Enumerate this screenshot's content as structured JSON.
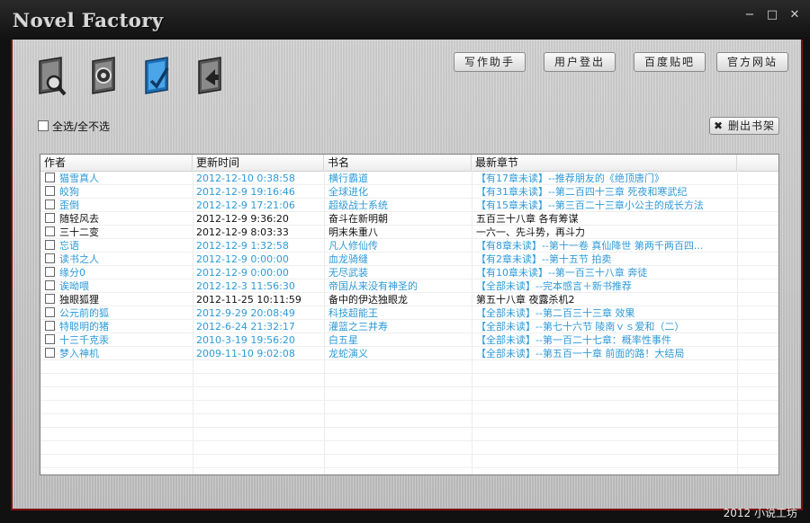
{
  "app": {
    "title": "Novel Factory",
    "footer": "2012 小说工坊"
  },
  "window_controls": {
    "minimize": "−",
    "maximize": "□",
    "close": "✕"
  },
  "toolbar": {
    "icons": [
      "search-book-icon",
      "settings-book-icon",
      "add-book-icon",
      "update-book-icon"
    ],
    "buttons": [
      "写作助手",
      "用户登出",
      "百度贴吧",
      "官方网站"
    ]
  },
  "controls": {
    "select_all": "全选/全不选",
    "delete_label": "删出书架",
    "delete_icon": "✖"
  },
  "table": {
    "headers": [
      "作者",
      "更新时间",
      "书名",
      "最新章节"
    ],
    "rows": [
      {
        "author": "猫雪真人",
        "time": "2012-12-10 0:38:58",
        "book": "横行霸道",
        "chapter": "【有17章未读】--推荐朋友的《绝顶唐门》",
        "style": "blue"
      },
      {
        "author": "皎狗",
        "time": "2012-12-9 19:16:46",
        "book": "全球进化",
        "chapter": "【有31章未读】--第二百四十三章  死夜和寒武纪",
        "style": "blue"
      },
      {
        "author": "歪倒",
        "time": "2012-12-9 17:21:06",
        "book": "超级战士系统",
        "chapter": "【有15章未读】--第三百二十三章小公主的成长方法",
        "style": "blue"
      },
      {
        "author": "随轻风去",
        "time": "2012-12-9 9:36:20",
        "book": "奋斗在新明朝",
        "chapter": "五百三十八章  各有筹谋",
        "style": "black"
      },
      {
        "author": "三十二变",
        "time": "2012-12-9 8:03:33",
        "book": "明末朱重八",
        "chapter": "一六一、先斗势，再斗力",
        "style": "black"
      },
      {
        "author": "忘语",
        "time": "2012-12-9 1:32:58",
        "book": "凡人修仙传",
        "chapter": "【有8章未读】--第十一卷  真仙降世  第两千两百四...",
        "style": "blue"
      },
      {
        "author": "读书之人",
        "time": "2012-12-9 0:00:00",
        "book": "血龙骑缝",
        "chapter": "【有2章未读】--第十五节  拍卖",
        "style": "blue"
      },
      {
        "author": "缘分0",
        "time": "2012-12-9 0:00:00",
        "book": "无尽武装",
        "chapter": "【有10章未读】--第一百三十八章  奔徒",
        "style": "blue"
      },
      {
        "author": "诶呦喂",
        "time": "2012-12-3 11:56:30",
        "book": "帝国从来没有神圣的",
        "chapter": "【全部未读】--完本感言＋新书推荐",
        "style": "blue"
      },
      {
        "author": "独眼狐狸",
        "time": "2012-11-25 10:11:59",
        "book": "备中的伊达独眼龙",
        "chapter": "第五十八章  夜露杀机2",
        "style": "black"
      },
      {
        "author": "公元前的狐",
        "time": "2012-9-29 20:08:49",
        "book": "科技超能王",
        "chapter": "【全部未读】--第二百三十三章      效果",
        "style": "blue"
      },
      {
        "author": "特聪明的猪",
        "time": "2012-6-24 21:32:17",
        "book": "灌篮之三井寿",
        "chapter": "【全部未读】--第七十六节  陵南ｖｓ爱和（二）",
        "style": "blue"
      },
      {
        "author": "十三千克汞",
        "time": "2010-3-19 19:56:20",
        "book": "白五星",
        "chapter": "【全部未读】--第一百二十七章：概率性事件",
        "style": "blue"
      },
      {
        "author": "梦入神机",
        "time": "2009-11-10 9:02:08",
        "book": "龙蛇演义",
        "chapter": "【全部未读】--第五百一十章    前面的路！大结局",
        "style": "blue"
      }
    ]
  }
}
